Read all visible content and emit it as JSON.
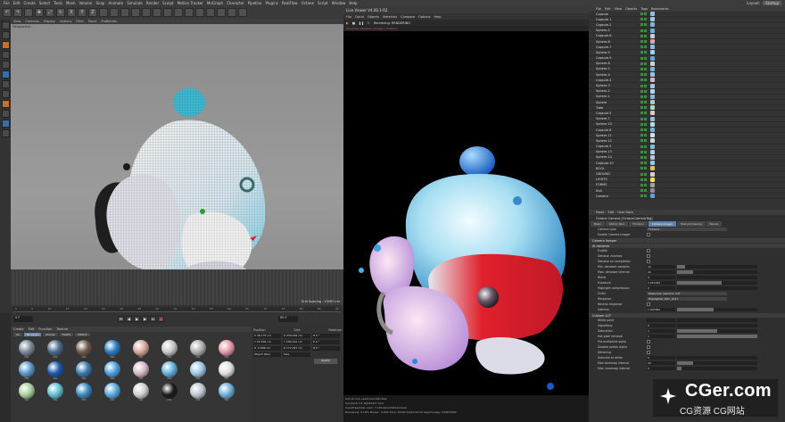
{
  "menubar": {
    "items": [
      "File",
      "Edit",
      "Create",
      "Select",
      "Tools",
      "Mesh",
      "Volume",
      "Snap",
      "Animate",
      "Simulate",
      "Render",
      "Sculpt",
      "Motion Tracker",
      "MoGraph",
      "Character",
      "Pipeline",
      "Plugins",
      "RealFlow",
      "Octane",
      "Script",
      "Window",
      "Help"
    ],
    "layout_label": "Layout:",
    "layout_value": "Startup"
  },
  "toolbar": {
    "icons": [
      "undo-icon",
      "redo-icon",
      "select-icon",
      "move-icon",
      "scale-icon",
      "rotate-icon"
    ],
    "axis_buttons": [
      "X",
      "Y",
      "Z"
    ]
  },
  "viewport": {
    "menu": [
      "View",
      "Cameras",
      "Display",
      "Options",
      "Filter",
      "Panel",
      "ProRender"
    ],
    "label": "Perspective",
    "grid_spacing": "Grid Spacing : 10000 cm"
  },
  "timeline": {
    "ticks": [
      "0",
      "5",
      "10",
      "15",
      "20",
      "25",
      "30",
      "35",
      "40",
      "45",
      "50",
      "55",
      "60",
      "65",
      "70",
      "75",
      "80",
      "85",
      "90"
    ],
    "frame": "0 F",
    "end_frame": "90 F"
  },
  "material_manager": {
    "menu": [
      "Create",
      "Edit",
      "Function",
      "Texture"
    ],
    "tabs": [
      "All",
      "No Layer",
      "Almost",
      "FAGES",
      "OR3CA"
    ],
    "materials": [
      {
        "color": "#7a8a9a",
        "name": "Mat"
      },
      {
        "color": "#4a6a8a",
        "name": "Mat"
      },
      {
        "color": "#6b5a4a",
        "name": "Mat"
      },
      {
        "color": "#2a7ac0",
        "name": "Mat"
      },
      {
        "color": "#d8a8a0",
        "name": "Mat"
      },
      {
        "color": "#c8c8c8",
        "name": "Mat"
      },
      {
        "color": "#b0b0b0",
        "name": "Mat"
      },
      {
        "color": "#e89aa8",
        "name": "Mat"
      },
      {
        "color": "#5a9ad0",
        "name": "Mat"
      },
      {
        "color": "#1a5ab0",
        "name": "Mat"
      },
      {
        "color": "#3a7ab0",
        "name": "Mat"
      },
      {
        "color": "#4aa0e0",
        "name": "Mat"
      },
      {
        "color": "#d8b8c8",
        "name": "Mat"
      },
      {
        "color": "#60b0e0",
        "name": "Mat"
      },
      {
        "color": "#a0c8e8",
        "name": "Mat"
      },
      {
        "color": "#e0e0e0",
        "name": "Mat"
      },
      {
        "color": "#a8d0a0",
        "name": "Mat"
      },
      {
        "color": "#60c0d0",
        "name": "Mat"
      },
      {
        "color": "#3a8ac0",
        "name": "Mat"
      },
      {
        "color": "#5aa8e0",
        "name": "Mat"
      },
      {
        "color": "#d0d0d0",
        "name": "Mat"
      },
      {
        "color": "#1a1a1a",
        "name": "Mat"
      },
      {
        "color": "#c0c8d0",
        "name": "Mat"
      },
      {
        "color": "#70b0d8",
        "name": "Mat"
      }
    ]
  },
  "coords": {
    "headers": [
      "Position",
      "Size",
      "Rotation"
    ],
    "rows": [
      [
        "X  38.137 cm",
        "X  239.182 cm",
        "H  0 °"
      ],
      [
        "Y  43.706 cm",
        "Y  230.132 cm",
        "P  0 °"
      ],
      [
        "Z  -5.686 cm",
        "Z  172.247 cm",
        "B  0 °"
      ]
    ],
    "mode1": "Object (Rel)",
    "mode2": "Size",
    "apply": "Apply"
  },
  "live_viewer": {
    "title": "Live Viewer V4.00.1-R2",
    "menu": [
      "File",
      "Cloud",
      "Objects",
      "Materials",
      "Compare",
      "Options",
      "Help"
    ],
    "status": "Rendering: RENDERING",
    "footer": [
      "Out-of-core used/max 0Kb/4Gb",
      "GreyS/16 1/1           Rgb32/64 1/24",
      "Used/free/total vram: 7.181Gb/4.002Gb/11Gb",
      "Rendering: 51.8%   Ms/sec: 4.093   Time: 00:00:12/00:00:29   Spp/maxspp: 2596/5000"
    ]
  },
  "object_manager": {
    "menu": [
      "File",
      "Edit",
      "View",
      "Objects",
      "Tags",
      "Bookmarks"
    ],
    "objects": [
      {
        "name": "Capsule",
        "tag": "#8ac0e0"
      },
      {
        "name": "Capsule.1",
        "tag": "#9ac8e8"
      },
      {
        "name": "Capsule.2",
        "tag": "#7ab8d8"
      },
      {
        "name": "Sphere.5",
        "tag": "#70b0e0"
      },
      {
        "name": "Capsule.6",
        "tag": "#c0d0e0"
      },
      {
        "name": "Sphere.8",
        "tag": "#e0a0b0"
      },
      {
        "name": "Capsule.7",
        "tag": "#80c0e8"
      },
      {
        "name": "Sphere.9",
        "tag": "#a0d0f0"
      },
      {
        "name": "Capsule.9",
        "tag": "#60a8d8"
      },
      {
        "name": "Sphere.6",
        "tag": "#d0d0d0"
      },
      {
        "name": "Sphere.5",
        "tag": "#70b8e0"
      },
      {
        "name": "Sphere.4",
        "tag": "#90c8e8"
      },
      {
        "name": "Capsule.4",
        "tag": "#e0b0c0"
      },
      {
        "name": "Sphere.3",
        "tag": "#a0c8e8"
      },
      {
        "name": "Sphere.2",
        "tag": "#b0d8f0"
      },
      {
        "name": "Sphere.1",
        "tag": "#80b8e0"
      },
      {
        "name": "Sphere",
        "tag": "#c0c0c0"
      },
      {
        "name": "Tube",
        "tag": "#a8d8c8"
      },
      {
        "name": "Capsule.5",
        "tag": "#e8c0c8"
      },
      {
        "name": "Sphere.7",
        "tag": "#90c0e0"
      },
      {
        "name": "Sphere.10",
        "tag": "#b8d8e8"
      },
      {
        "name": "Capsule.8",
        "tag": "#7ab0d8"
      },
      {
        "name": "Sphere.11",
        "tag": "#c8e0f0"
      },
      {
        "name": "Sphere.12",
        "tag": "#d0d8e0"
      },
      {
        "name": "Capsule.3",
        "tag": "#8ab8d8"
      },
      {
        "name": "Sphere.13",
        "tag": "#a8d0e8"
      },
      {
        "name": "Sphere.14",
        "tag": "#b8c8d8"
      },
      {
        "name": "Capsule.10",
        "tag": "#90c8e8"
      },
      {
        "name": "BOOL",
        "tag": "#e0c060"
      },
      {
        "name": "GROUND",
        "tag": "#d0d0d0"
      },
      {
        "name": "LIGHTS",
        "tag": "#f0e060"
      },
      {
        "name": "FORMS",
        "tag": "#a0a0a0"
      },
      {
        "name": "Null",
        "tag": "#909090"
      },
      {
        "name": "Camera",
        "tag": "#60a0e0"
      }
    ]
  },
  "attribute_manager": {
    "menu": [
      "Mode",
      "Edit",
      "User Data"
    ],
    "title": "Octane Camera [OctaneCameraTag]",
    "tabs": [
      "Basic",
      "Motion Blur",
      "Thinlens",
      "Camera Imager",
      "Post processing",
      "Stereo"
    ],
    "active_tab": "Camera Imager",
    "camera_type_label": "Camera type",
    "camera_type_value": "Thinlens",
    "enable_label": "Enable Camera Imager",
    "section1": "Camera Imager",
    "section2": "AI denoiser",
    "denoiser_rows": [
      {
        "label": "Enable",
        "type": "check"
      },
      {
        "label": "Denoise volumes",
        "type": "check"
      },
      {
        "label": "Denoise on completion",
        "type": "check"
      },
      {
        "label": "Min. denoiser samples",
        "type": "slider",
        "value": "10",
        "fill": 0.1
      },
      {
        "label": "Max. denoiser interval",
        "type": "slider",
        "value": "20",
        "fill": 0.2
      },
      {
        "label": "Blend",
        "type": "slider",
        "value": "0",
        "fill": 0
      }
    ],
    "imager_rows": [
      {
        "label": "Exposure",
        "type": "slider",
        "value": "1.257287",
        "fill": 0.55
      },
      {
        "label": "Highlight compression",
        "type": "slider",
        "value": "0",
        "fill": 0
      },
      {
        "label": "Order",
        "type": "dropdown",
        "value": "Response, Gamma, LUT"
      },
      {
        "label": "Response",
        "type": "dropdown",
        "value": "Highlighter_Film_2017"
      },
      {
        "label": "Neutral response",
        "type": "check"
      },
      {
        "label": "Gamma",
        "type": "slider",
        "value": "1.007891",
        "fill": 0.45
      }
    ],
    "section3": "Custom LUT",
    "lut_rows": [
      {
        "label": "White point",
        "type": "slider",
        "value": "",
        "fill": 0
      },
      {
        "label": "Vignetting",
        "type": "slider",
        "value": "0",
        "fill": 0
      },
      {
        "label": "Saturation",
        "type": "slider",
        "value": "1",
        "fill": 0.5
      },
      {
        "label": "Hot pixel removal",
        "type": "slider",
        "value": "1",
        "fill": 1
      },
      {
        "label": "Pre-multiplied alpha",
        "type": "check"
      },
      {
        "label": "Disable partial alpha",
        "type": "check"
      },
      {
        "label": "Dithering",
        "type": "check"
      },
      {
        "label": "Saturate to white",
        "type": "slider",
        "value": "0",
        "fill": 0
      },
      {
        "label": "Max tonemap interval",
        "type": "slider",
        "value": "20",
        "fill": 0.2
      },
      {
        "label": "Max. tonemap interval",
        "type": "slider",
        "value": "5",
        "fill": 0.05
      }
    ]
  },
  "watermark": {
    "main": "CGer.com",
    "sub": "CG资源  CG网站"
  }
}
